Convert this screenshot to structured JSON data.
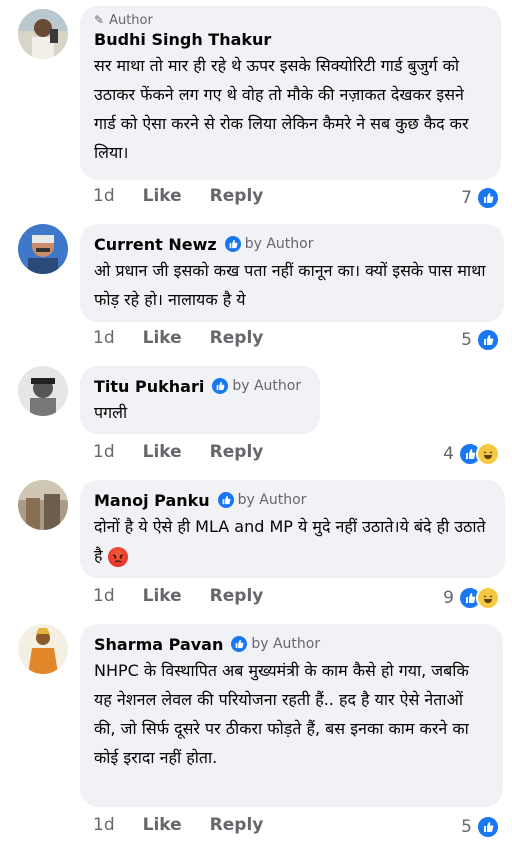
{
  "comments": [
    {
      "name": "Budhi Singh Thakur",
      "top_badge": "Author",
      "text": "सर माथा तो मार ही रहे थे ऊपर इसके सिक्योरिटी गार्ड बुजुर्ग को उठाकर फेंकने लग गए थे वोह तो मौके की नज़ाकत देखकर इसने गार्ड को ऐसा करने से रोक लिया लेकिन कैमरे ने सब कुछ कैद कर लिया।",
      "time": "1d",
      "like": "Like",
      "reply": "Reply",
      "reactions": "7"
    },
    {
      "name": "Current Newz",
      "badge": "by Author",
      "text": "ओ प्रधान जी इसको कख पता नहीं कानून का। क्यों इसके पास माथा फोड़ रहे हो। नालायक है ये",
      "time": "1d",
      "like": "Like",
      "reply": "Reply",
      "reactions": "5"
    },
    {
      "name": "Titu Pukhari",
      "badge": "by Author",
      "text": "पगली",
      "time": "1d",
      "like": "Like",
      "reply": "Reply",
      "reactions": "4"
    },
    {
      "name": "Manoj Panku",
      "badge": "by Author",
      "text": "दोनों है ये ऐसे ही MLA and MP ये मुदे नहीं उठाते।ये बंदे ही उठाते है",
      "time": "1d",
      "like": "Like",
      "reply": "Reply",
      "reactions": "9"
    },
    {
      "name": "Sharma Pavan",
      "badge": "by Author",
      "text": "NHPC के विस्थापित अब मुख्यमंत्री के काम कैसे हो गया, जबकि यह नेशनल लेवल की परियोजना रहती हैं.. हद है यार ऐसे नेताओं की, जो सिर्फ दूसरे पर ठीकरा फोड़ते हैं, बस इनका काम करने का कोई इरादा नहीं होता.",
      "time": "1d",
      "like": "Like",
      "reply": "Reply",
      "reactions": "5"
    }
  ],
  "colors": {
    "link_blue": "#1877f2",
    "bubble": "#f0f2f5",
    "meta": "#65676b"
  }
}
